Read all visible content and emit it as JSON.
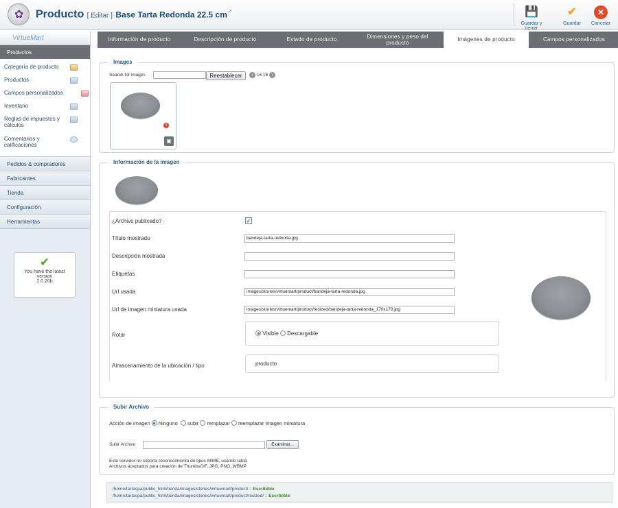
{
  "header": {
    "title": "Producto",
    "edit_label": "[ Editar ]",
    "product_name": "Base Tarta Redonda 22.5 cm",
    "save_close_label": "Guardar y cerrar",
    "save_label": "Guardar",
    "cancel_label": "Cancelar"
  },
  "sidebar": {
    "brand": "VirtueMart",
    "section_title": "Productos",
    "items": [
      {
        "label": "Categoría de producto"
      },
      {
        "label": "Productos"
      },
      {
        "label": "Campos personalizados"
      },
      {
        "label": "Inventario"
      },
      {
        "label": "Reglas de impuestos y cálculos"
      },
      {
        "label": "Comentarios y calificaciones"
      }
    ],
    "sections": [
      "Pedidos & compradores",
      "Fabricantes",
      "Tienda",
      "Configuración",
      "Herramientas"
    ],
    "version": {
      "line1": "You have the latest",
      "line2": "version",
      "line3": "2.0.20b"
    }
  },
  "tabs": [
    {
      "label": "Información de producto"
    },
    {
      "label": "Descripción de producto"
    },
    {
      "label": "Estado de producto"
    },
    {
      "label": "Dimensiones y peso del producto"
    },
    {
      "label": "Imágenes de producto",
      "active": true
    },
    {
      "label": "Campos personalizados"
    }
  ],
  "images": {
    "legend": "Images",
    "search_label": "Search for images",
    "search_value": "",
    "reset_label": "Reestablecer",
    "page_a": "16",
    "page_b": "16"
  },
  "image_info": {
    "legend": "Información de la imagen",
    "published_label": "¿Archivo publicado?",
    "published": true,
    "title_label": "Título mostrado",
    "title_value": "bandeja-tarta-redonda.jpg",
    "desc_label": "Descripción mostrada",
    "desc_value": "",
    "tags_label": "Etiquetas",
    "tags_value": "",
    "url_label": "Url usada",
    "url_value": "images/stories/virtuemart/product/bandeja-tarta-redonda.jpg",
    "thumb_url_label": "Url de imagen miniatura usada",
    "thumb_url_value": "images/stories/virtuemart/product/resized/bandeja-tarta-redonda_170x170.jpg",
    "rotate_label": "Rotar",
    "rotate_opt1": "Visible",
    "rotate_opt2": "Descargable",
    "rotate_selected": "Visible",
    "storage_label": "Almacenamiento de la ubicación / tipo",
    "storage_value": "producto"
  },
  "upload": {
    "legend": "Subir Archivo",
    "action_label": "Acción de imagen",
    "opt_none": "Ninguno",
    "opt_upload": "subir",
    "opt_replace": "remplazar",
    "opt_replace_thumb": "reemplazar imagen miniatura",
    "selected": "Ninguno",
    "file_label": "Subir Archivo",
    "browse_label": "Examinar...",
    "note1": "Este servidor no soporta reconocimiento de tipos MIME, usando tabla",
    "note2": "Archivos aceptados para creación de ThumbsGIF, JPG, PNG, WBMP"
  },
  "paths": {
    "path1": "/home/tartaspa/public_html/tienda/images/stories/virtuemart/product/",
    "path2": "/home/tartaspa/public_html/tienda/images/stories/virtuemart/product/resized/",
    "separator": " :: ",
    "status": "Escribible"
  },
  "colors": {
    "accent": "#1d4f7c",
    "tabbar": "#6b6f73",
    "writable": "#2f8a1f"
  }
}
